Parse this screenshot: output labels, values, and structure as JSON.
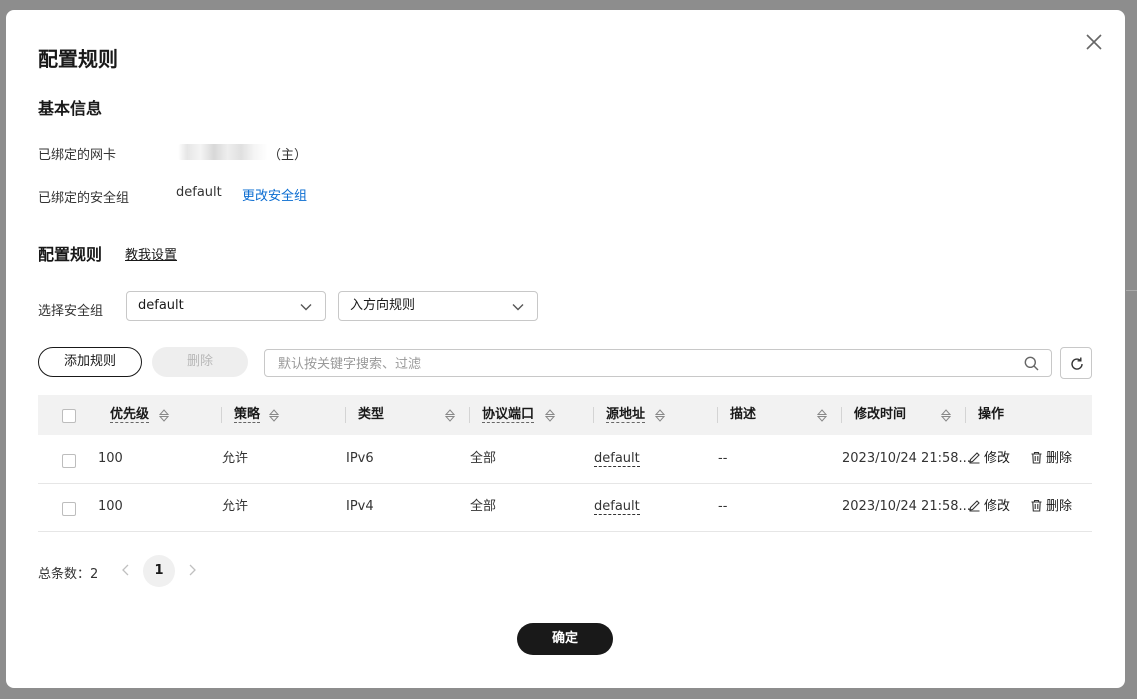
{
  "dialog": {
    "title": "配置规则",
    "basic_info": {
      "heading": "基本信息",
      "nic_label": "已绑定的网卡",
      "nic_suffix": "（主）",
      "sg_label": "已绑定的安全组",
      "sg_value": "default",
      "change_sg_link": "更改安全组"
    },
    "rules": {
      "heading": "配置规则",
      "help_link": "教我设置",
      "select_sg_label": "选择安全组",
      "sg_select_value": "default",
      "direction_select_value": "入方向规则",
      "add_button": "添加规则",
      "delete_button": "删除",
      "search_placeholder": "默认按关键字搜索、过滤"
    },
    "table": {
      "columns": [
        "优先级",
        "策略",
        "类型",
        "协议端口",
        "源地址",
        "描述",
        "修改时间",
        "操作"
      ],
      "rows": [
        {
          "priority": "100",
          "policy": "允许",
          "type": "IPv6",
          "port": "全部",
          "source": "default",
          "desc": "--",
          "time": "2023/10/24 21:58...",
          "edit": "修改",
          "delete": "删除"
        },
        {
          "priority": "100",
          "policy": "允许",
          "type": "IPv4",
          "port": "全部",
          "source": "default",
          "desc": "--",
          "time": "2023/10/24 21:58...",
          "edit": "修改",
          "delete": "删除"
        }
      ]
    },
    "pagination": {
      "total_label": "总条数：2",
      "current_page": "1"
    },
    "confirm_button": "确定"
  },
  "colors": {
    "link": "#0a6cd1",
    "primary_button": "#191919",
    "header_bg": "#f2f2f2"
  },
  "icons": [
    "close-icon",
    "chevron-down-icon",
    "search-icon",
    "refresh-icon",
    "sort-icon",
    "edit-icon",
    "trash-icon",
    "chevron-left-icon",
    "chevron-right-icon"
  ]
}
